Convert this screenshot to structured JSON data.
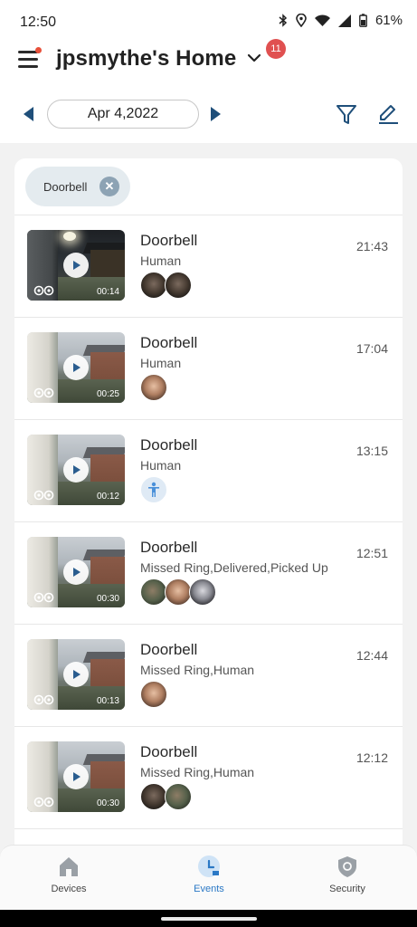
{
  "status_bar": {
    "time": "12:50",
    "battery": "61%",
    "icons": [
      "bluetooth-icon",
      "location-icon",
      "wifi-icon",
      "signal-icon",
      "battery-icon"
    ]
  },
  "header": {
    "title": "jpsmythe's Home",
    "notification_count": "11",
    "date": "Apr 4,2022"
  },
  "filter": {
    "chip_label": "Doorbell"
  },
  "events": [
    {
      "title": "Doorbell",
      "subtitle": "Human",
      "time": "21:43",
      "duration": "00:14",
      "night": true,
      "faces": [
        "dark",
        "dark"
      ]
    },
    {
      "title": "Doorbell",
      "subtitle": "Human",
      "time": "17:04",
      "duration": "00:25",
      "night": false,
      "faces": [
        "pale"
      ]
    },
    {
      "title": "Doorbell",
      "subtitle": "Human",
      "time": "13:15",
      "duration": "00:12",
      "night": false,
      "faces": [
        "human-icon"
      ]
    },
    {
      "title": "Doorbell",
      "subtitle": "Missed Ring,Delivered,Picked Up",
      "time": "12:51",
      "duration": "00:30",
      "night": false,
      "faces": [
        "green",
        "pale",
        "grey"
      ]
    },
    {
      "title": "Doorbell",
      "subtitle": "Missed Ring,Human",
      "time": "12:44",
      "duration": "00:13",
      "night": false,
      "faces": [
        "pale"
      ]
    },
    {
      "title": "Doorbell",
      "subtitle": "Missed Ring,Human",
      "time": "12:12",
      "duration": "00:30",
      "night": false,
      "faces": [
        "dark",
        "green"
      ]
    }
  ],
  "bottom_nav": {
    "items": [
      {
        "label": "Devices",
        "icon": "home-icon",
        "active": false
      },
      {
        "label": "Events",
        "icon": "clock-icon",
        "active": true
      },
      {
        "label": "Security",
        "icon": "shield-icon",
        "active": false
      }
    ]
  },
  "colors": {
    "accent": "#2a78c5",
    "badge": "#e05050",
    "chip": "#e4ebef",
    "nav_arrow": "#1f4f7a"
  }
}
